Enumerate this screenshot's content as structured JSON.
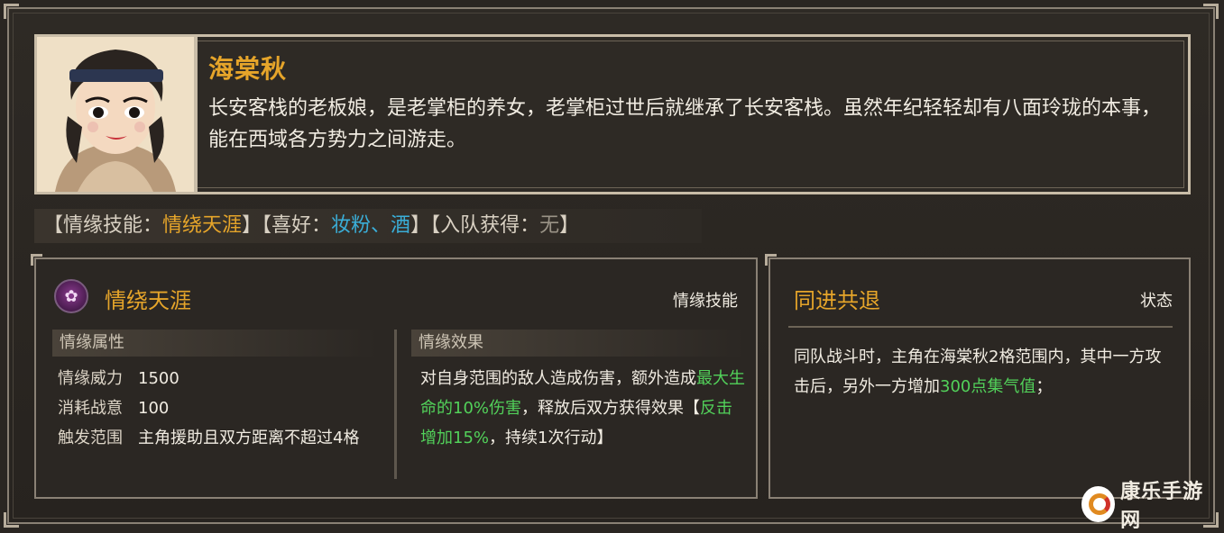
{
  "hero": {
    "name": "海棠秋",
    "description": "长安客栈的老板娘，是老掌柜的养女，老掌柜过世后就继承了长安客栈。虽然年纪轻轻却有八面玲珑的本事，能在西域各方势力之间游走。"
  },
  "tagline": {
    "p1": "【情缘技能：",
    "skill": "情绕天涯",
    "p2": "】【喜好：",
    "likes": "妆粉、酒",
    "p3": "】【入队获得：",
    "join": "无",
    "p4": "】"
  },
  "skill": {
    "title": "情绕天涯",
    "type": "情缘技能",
    "attr_header": "情缘属性",
    "effect_header": "情缘效果",
    "attributes": [
      {
        "key": "情缘威力",
        "value": "1500"
      },
      {
        "key": "消耗战意",
        "value": "100"
      },
      {
        "key": "触发范围",
        "value": "主角援助且双方距离不超过4格"
      }
    ],
    "effect_a": "对自身范围的敌人造成伤害，额外造成",
    "effect_b": "最大生命的10%伤害",
    "effect_c": "，释放后双方获得效果【",
    "effect_d": "反击增加15%",
    "effect_e": "，持续1次行动】"
  },
  "state": {
    "title": "同进共退",
    "type": "状态",
    "desc_a": "同队战斗时，主角在海棠秋2格范围内，其中一方攻击后，另外一方增加",
    "desc_b": "300点集气值",
    "desc_c": "；"
  },
  "watermark": {
    "text": "康乐手游网"
  },
  "colors": {
    "gold": "#e6a52a",
    "blue": "#3aaed8",
    "green": "#52d15a"
  }
}
